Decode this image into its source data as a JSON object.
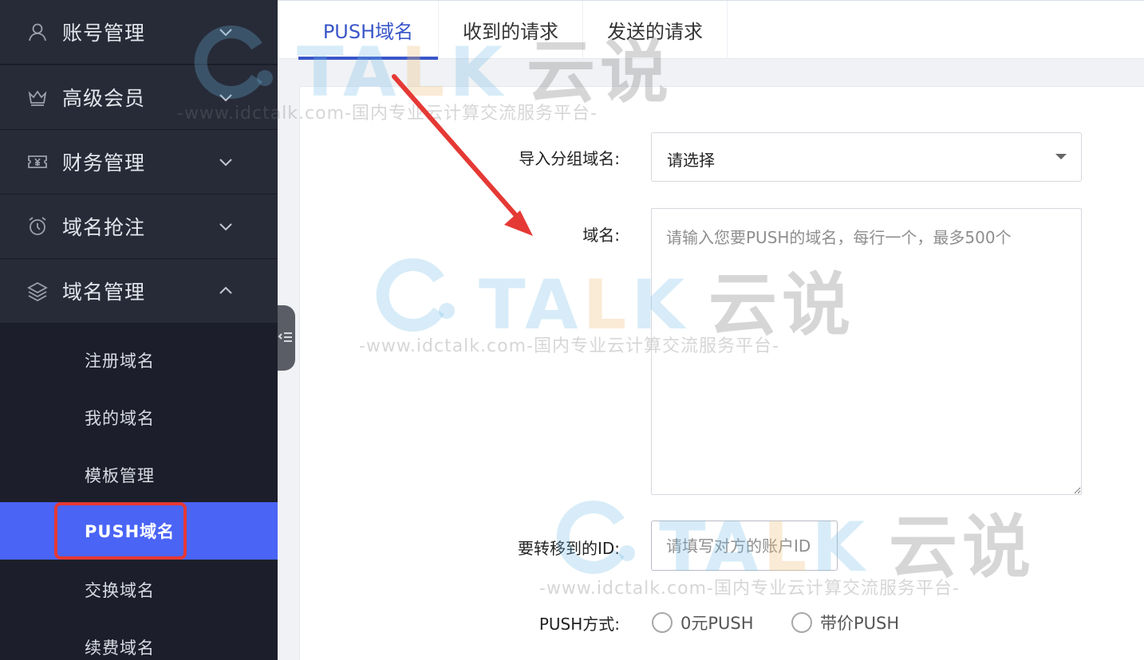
{
  "sidebar": {
    "groups": [
      {
        "label": "账号管理",
        "icon": "user-icon",
        "chevron": "chevron-down-icon"
      },
      {
        "label": "高级会员",
        "icon": "crown-icon",
        "chevron": "chevron-down-icon"
      },
      {
        "label": "财务管理",
        "icon": "yen-ticket-icon",
        "chevron": "chevron-down-icon"
      },
      {
        "label": "域名抢注",
        "icon": "alarm-clock-icon",
        "chevron": "chevron-down-icon"
      },
      {
        "label": "域名管理",
        "icon": "layers-icon",
        "chevron": "chevron-up-icon"
      }
    ],
    "sub_items": [
      {
        "label": "注册域名"
      },
      {
        "label": "我的域名"
      },
      {
        "label": "模板管理"
      },
      {
        "label": "PUSH域名",
        "active": true
      },
      {
        "label": "交换域名"
      },
      {
        "label": "续费域名"
      }
    ],
    "active_color": "#4a64f5",
    "highlight_color": "#e53935"
  },
  "tabs": [
    {
      "label": "PUSH域名",
      "active": true
    },
    {
      "label": "收到的请求"
    },
    {
      "label": "发送的请求"
    }
  ],
  "form": {
    "import_group_label": "导入分组域名:",
    "import_group_value": "请选择",
    "domain_label": "域名:",
    "domain_placeholder": "请输入您要PUSH的域名，每行一个，最多500个",
    "target_id_label": "要转移到的ID:",
    "target_id_placeholder": "请填写对方的账户ID",
    "push_method_label": "PUSH方式:",
    "push_options": [
      {
        "label": "0元PUSH"
      },
      {
        "label": "带价PUSH"
      }
    ]
  },
  "watermark": {
    "brand_prefix": "TA",
    "brand_mid": "L",
    "brand_suffix": "K",
    "brand_cn": "云说",
    "tagline": "-www.idctalk.com-国内专业云计算交流服务平台-"
  },
  "accent_color": "#3a56c9"
}
